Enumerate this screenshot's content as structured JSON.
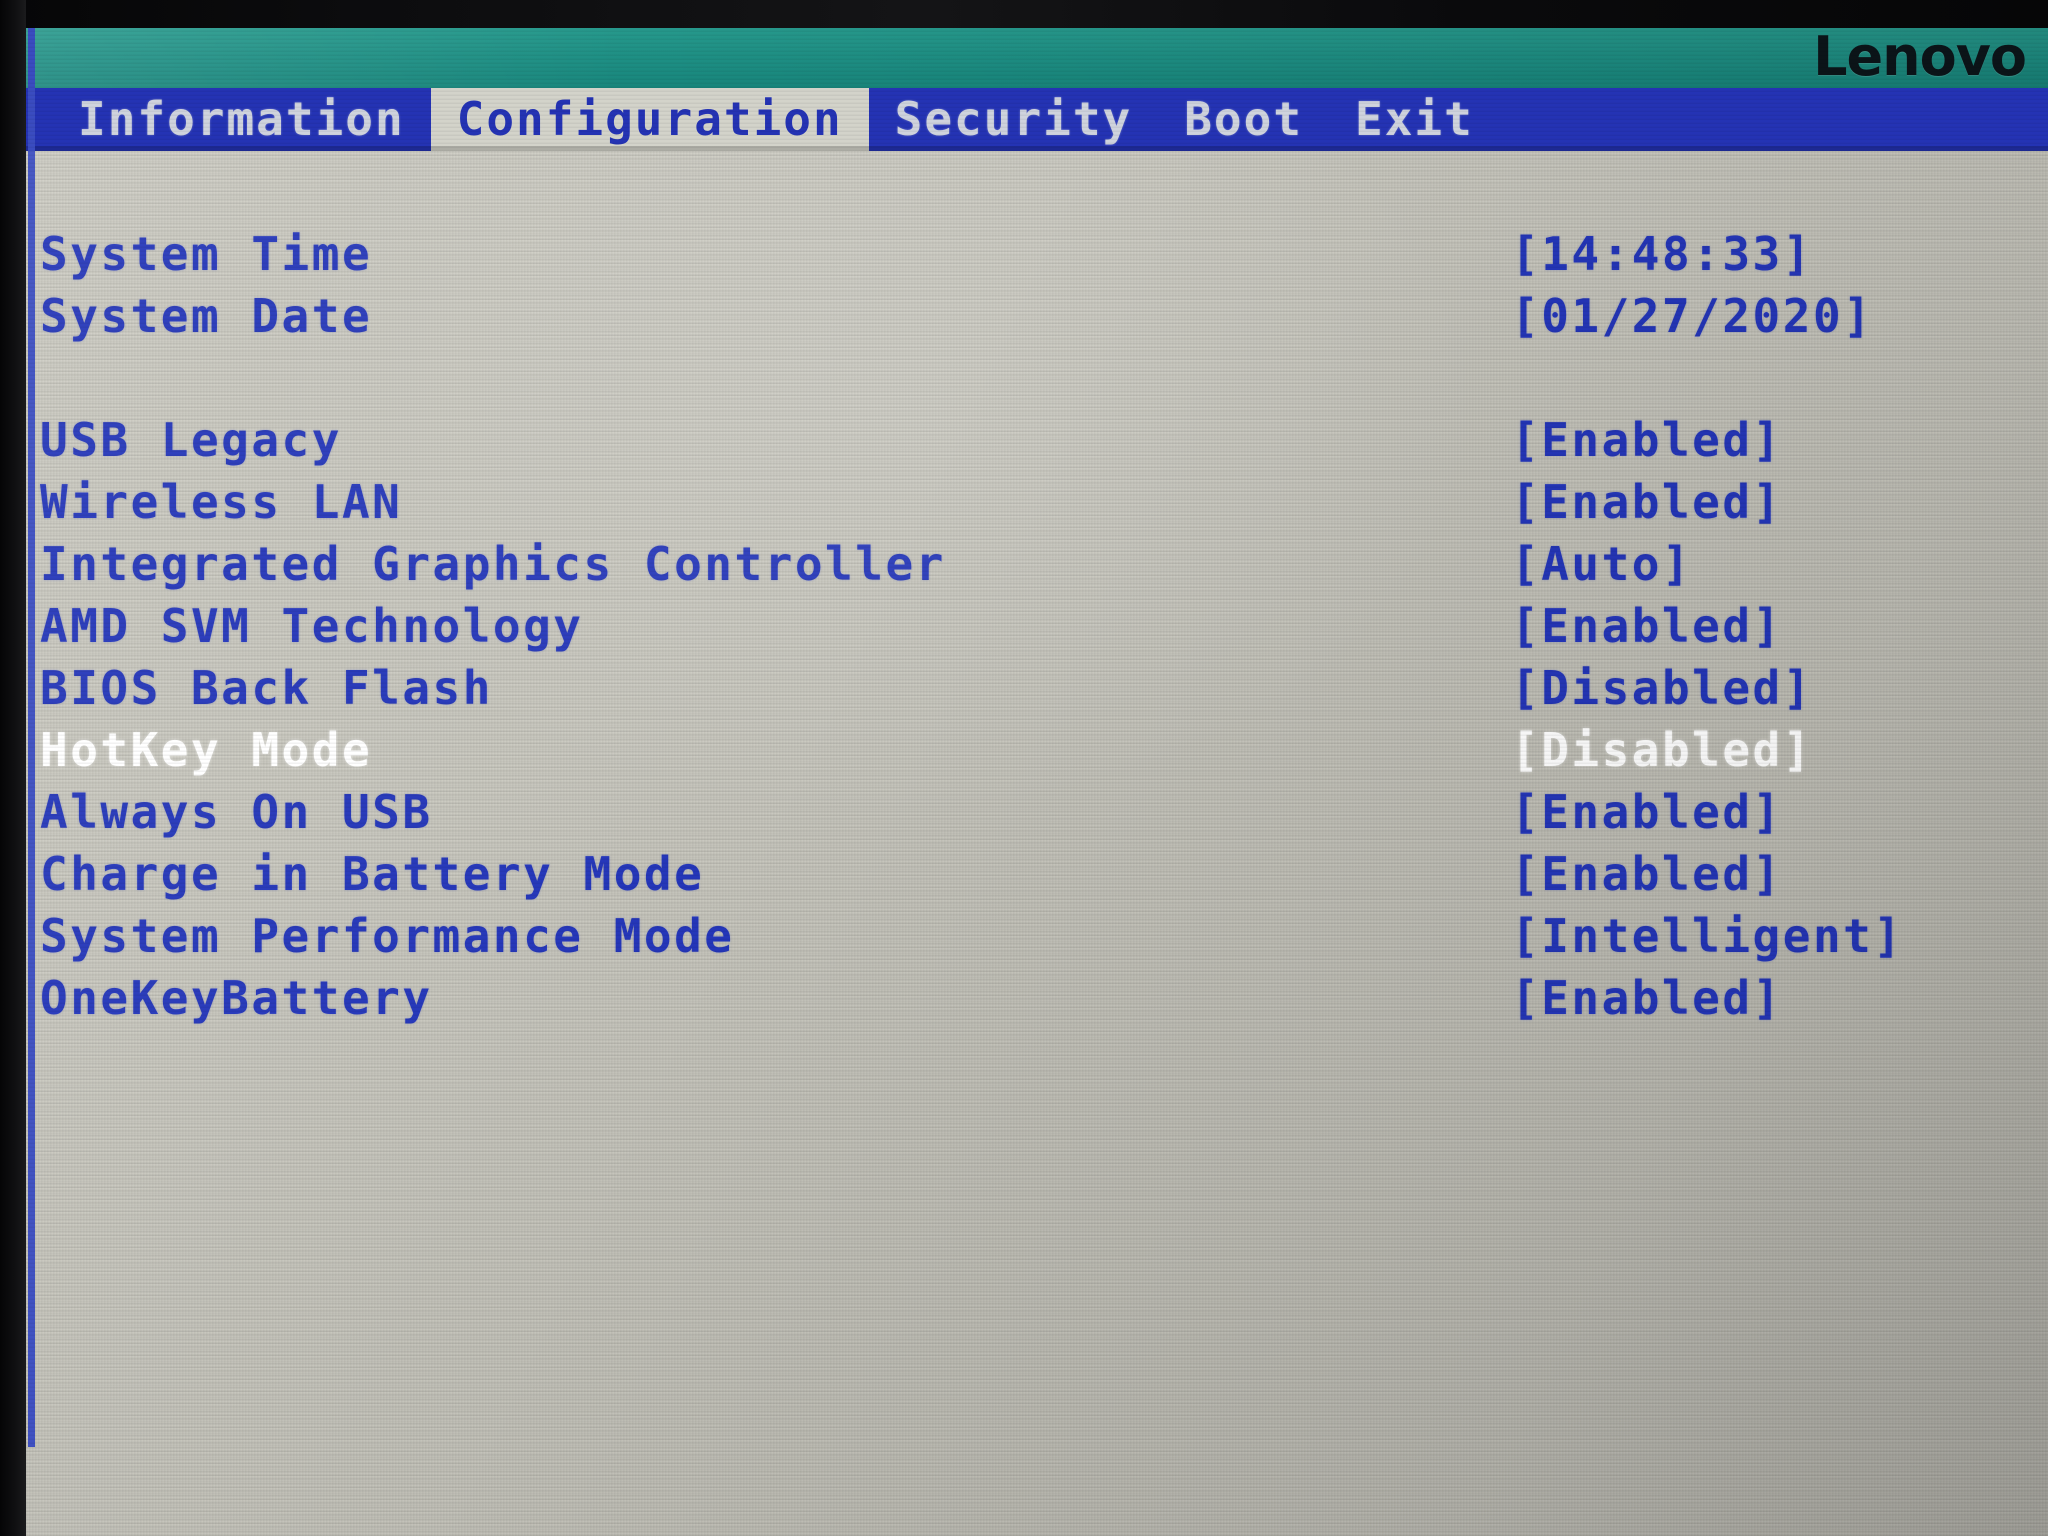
{
  "brand": {
    "logo_text": "Lenovo"
  },
  "menu": {
    "tabs": [
      {
        "label": "Information",
        "active": false
      },
      {
        "label": "Configuration",
        "active": true
      },
      {
        "label": "Security",
        "active": false
      },
      {
        "label": "Boot",
        "active": false
      },
      {
        "label": "Exit",
        "active": false
      }
    ]
  },
  "colors": {
    "banner_teal": "#1d8e83",
    "menubar_blue": "#2433b4",
    "panel_grey": "#c9c8bf",
    "text_blue": "#2436b9",
    "selected_white": "#ffffff",
    "active_tab_bg": "#d3d3ca",
    "frame_blue": "#3a4cc0"
  },
  "settings": [
    {
      "label": "System Time",
      "value": "[14:48:33]",
      "selected": false
    },
    {
      "label": "System Date",
      "value": "[01/27/2020]",
      "selected": false
    },
    {
      "label": "USB Legacy",
      "value": "[Enabled]",
      "selected": false
    },
    {
      "label": "Wireless LAN",
      "value": "[Enabled]",
      "selected": false
    },
    {
      "label": "Integrated Graphics Controller",
      "value": "[Auto]",
      "selected": false
    },
    {
      "label": "AMD SVM Technology",
      "value": "[Enabled]",
      "selected": false
    },
    {
      "label": "BIOS Back Flash",
      "value": "[Disabled]",
      "selected": false
    },
    {
      "label": "HotKey Mode",
      "value": "[Disabled]",
      "selected": true
    },
    {
      "label": "Always On USB",
      "value": "[Enabled]",
      "selected": false
    },
    {
      "label": "Charge in Battery Mode",
      "value": "[Enabled]",
      "selected": false
    },
    {
      "label": "System Performance Mode",
      "value": "[Intelligent]",
      "selected": false
    },
    {
      "label": "OneKeyBattery",
      "value": "[Enabled]",
      "selected": false
    }
  ]
}
